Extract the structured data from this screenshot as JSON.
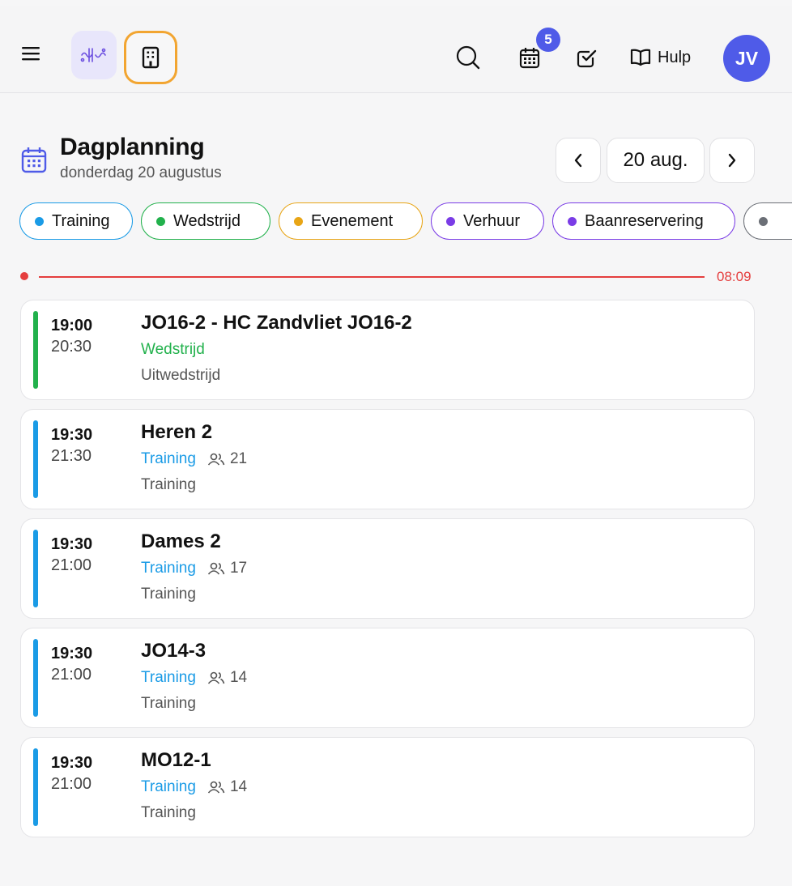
{
  "topbar": {
    "notifications_count": "5",
    "help_label": "Hulp",
    "avatar_initials": "JV",
    "accent": "#4f5be8",
    "active_outline": "#f2a531"
  },
  "header": {
    "title": "Dagplanning",
    "subtitle": "donderdag 20 augustus",
    "date_label": "20 aug."
  },
  "filters": [
    {
      "label": "Training",
      "color": "#1a9be6"
    },
    {
      "label": "Wedstrijd",
      "color": "#22b14c"
    },
    {
      "label": "Evenement",
      "color": "#e8a516"
    },
    {
      "label": "Verhuur",
      "color": "#7a3ce6"
    },
    {
      "label": "Baanreservering",
      "color": "#7a3ce6"
    },
    {
      "label": "",
      "color": "#6b6f76"
    }
  ],
  "now_indicator": {
    "time": "08:09",
    "color": "#e53e3e"
  },
  "events": [
    {
      "start": "19:00",
      "end": "20:30",
      "title": "JO16-2 - HC Zandvliet JO16-2",
      "type": "Wedstrijd",
      "type_color": "#22b14c",
      "count": "",
      "description": "Uitwedstrijd"
    },
    {
      "start": "19:30",
      "end": "21:30",
      "title": "Heren 2",
      "type": "Training",
      "type_color": "#1a9be6",
      "count": "21",
      "description": "Training"
    },
    {
      "start": "19:30",
      "end": "21:00",
      "title": "Dames 2",
      "type": "Training",
      "type_color": "#1a9be6",
      "count": "17",
      "description": "Training"
    },
    {
      "start": "19:30",
      "end": "21:00",
      "title": "JO14-3",
      "type": "Training",
      "type_color": "#1a9be6",
      "count": "14",
      "description": "Training"
    },
    {
      "start": "19:30",
      "end": "21:00",
      "title": "MO12-1",
      "type": "Training",
      "type_color": "#1a9be6",
      "count": "14",
      "description": "Training"
    }
  ]
}
